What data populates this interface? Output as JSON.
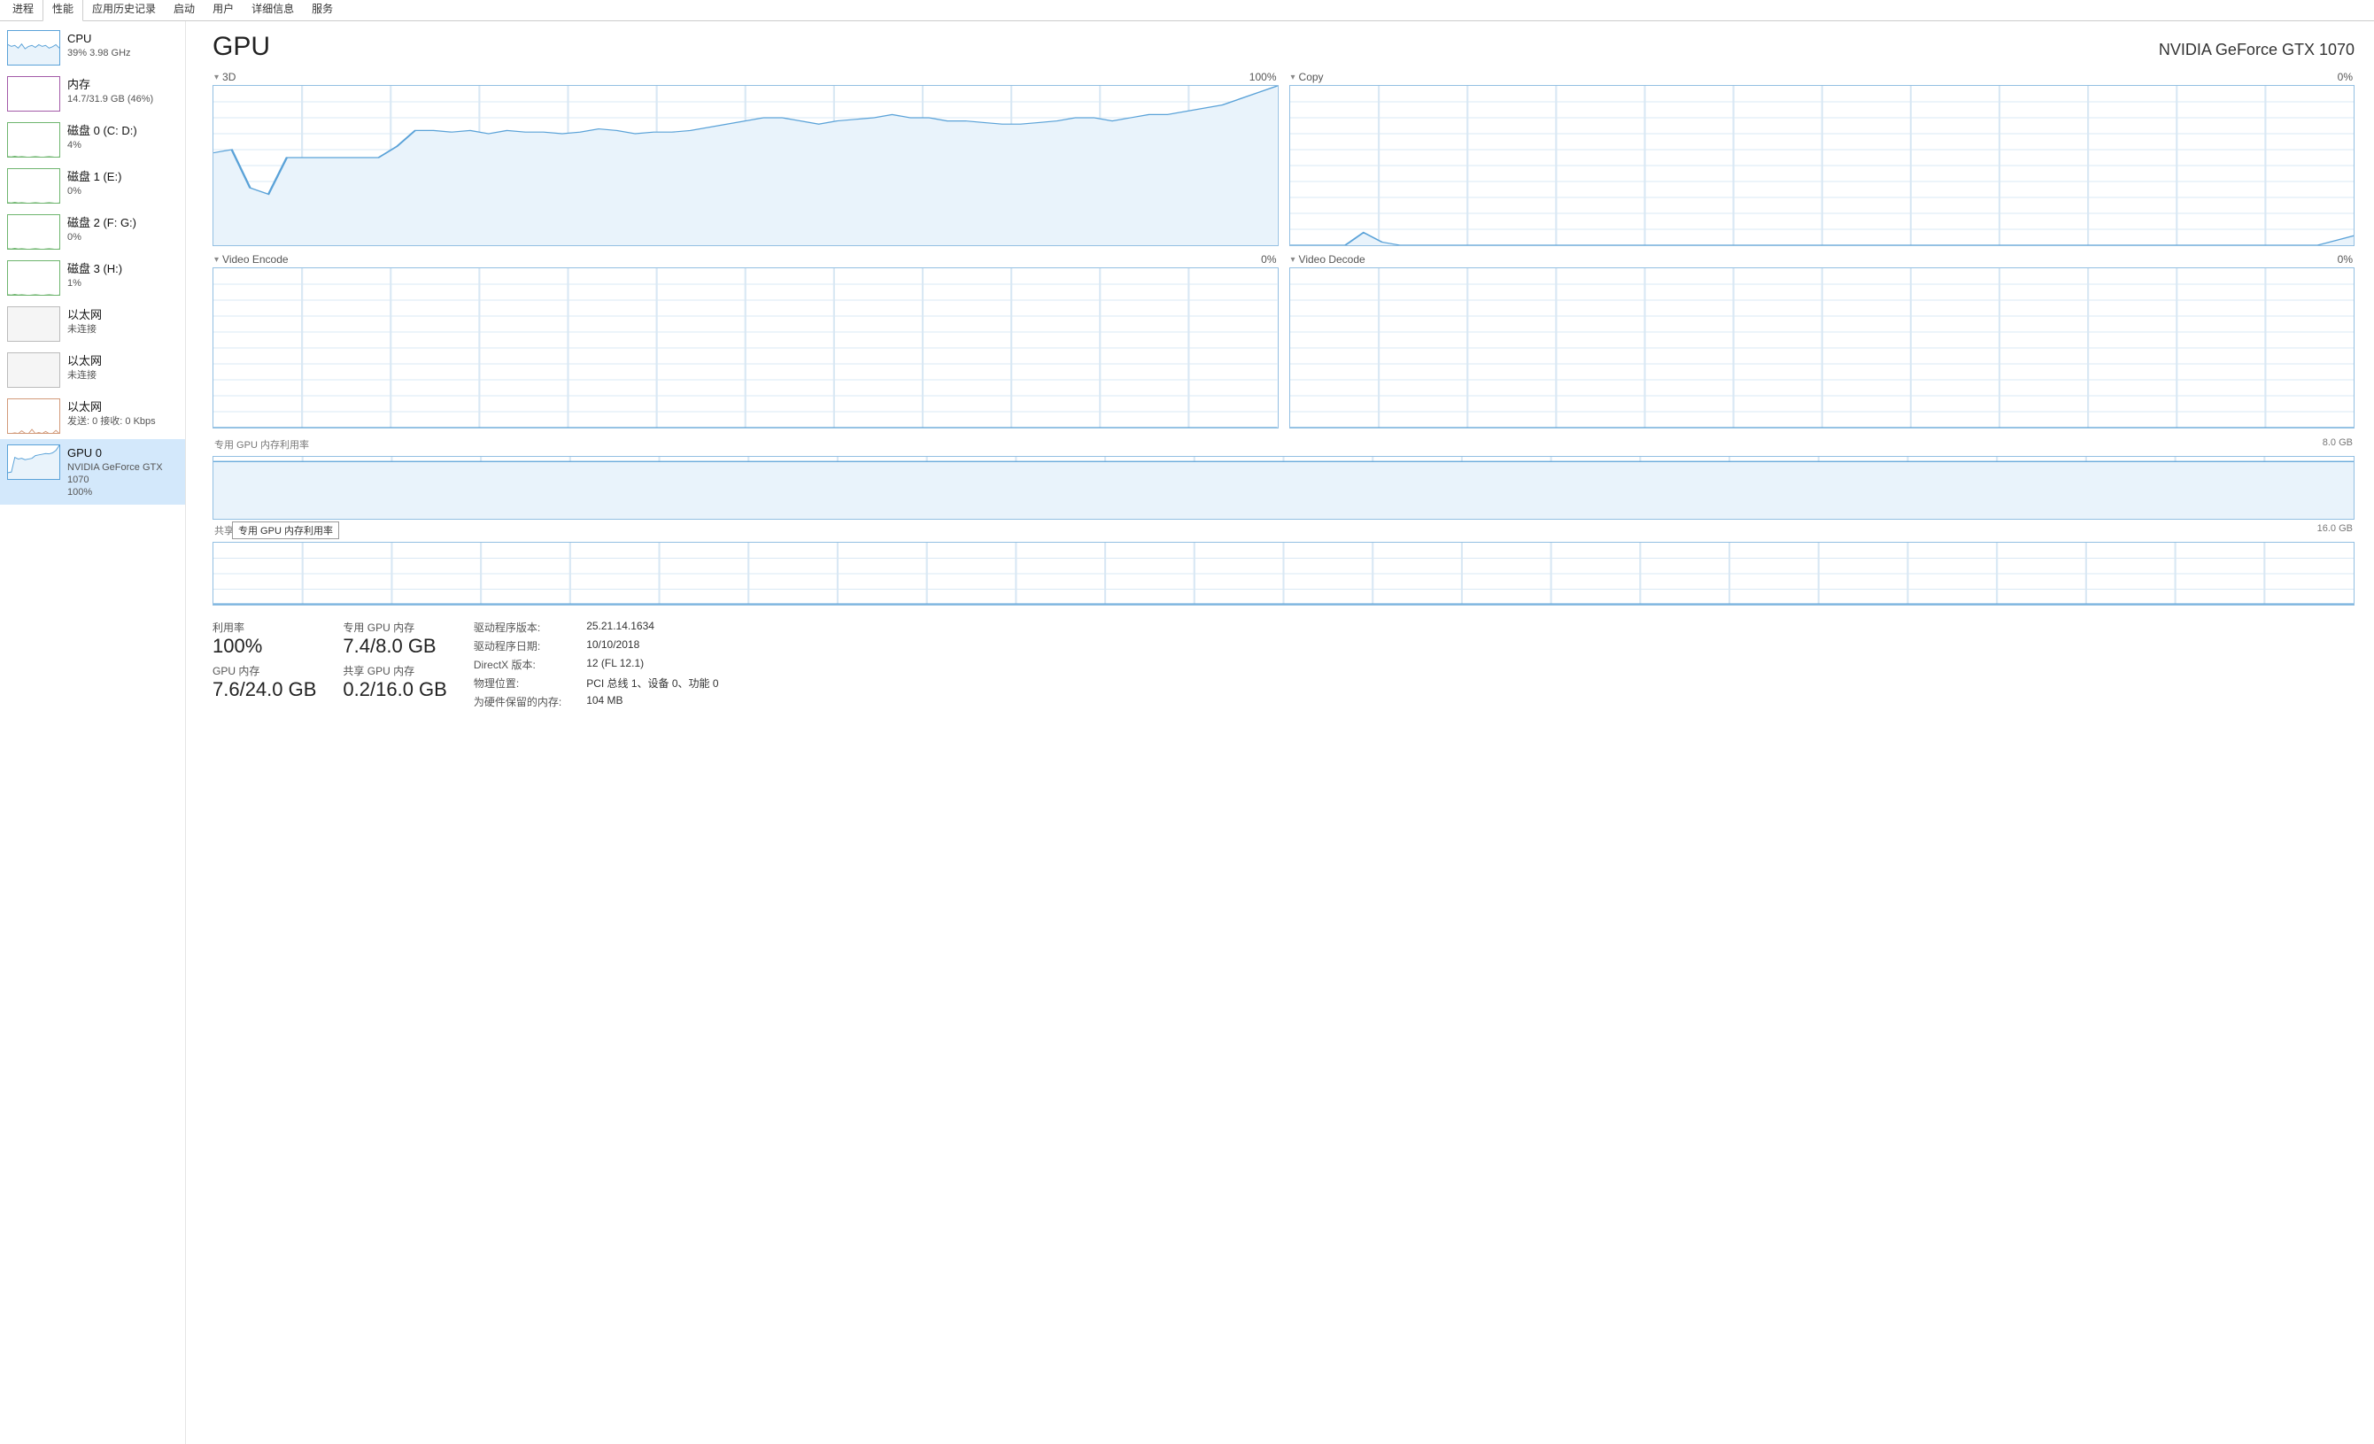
{
  "tabs": [
    "进程",
    "性能",
    "应用历史记录",
    "启动",
    "用户",
    "详细信息",
    "服务"
  ],
  "active_tab_index": 1,
  "sidebar": [
    {
      "id": "cpu",
      "title": "CPU",
      "sub": "39% 3.98 GHz",
      "thumb": "cpu"
    },
    {
      "id": "mem",
      "title": "内存",
      "sub": "14.7/31.9 GB (46%)",
      "thumb": "mem"
    },
    {
      "id": "disk0",
      "title": "磁盘 0 (C: D:)",
      "sub": "4%",
      "thumb": "disk"
    },
    {
      "id": "disk1",
      "title": "磁盘 1 (E:)",
      "sub": "0%",
      "thumb": "disk"
    },
    {
      "id": "disk2",
      "title": "磁盘 2 (F: G:)",
      "sub": "0%",
      "thumb": "disk"
    },
    {
      "id": "disk3",
      "title": "磁盘 3 (H:)",
      "sub": "1%",
      "thumb": "disk"
    },
    {
      "id": "eth0",
      "title": "以太网",
      "sub": "未连接",
      "thumb": "eth"
    },
    {
      "id": "eth1",
      "title": "以太网",
      "sub": "未连接",
      "thumb": "eth"
    },
    {
      "id": "eth2",
      "title": "以太网",
      "sub": "发送: 0 接收: 0 Kbps",
      "thumb": "eth2"
    },
    {
      "id": "gpu0",
      "title": "GPU 0",
      "sub": "NVIDIA GeForce GTX 1070",
      "sub2": "100%",
      "thumb": "gpu",
      "selected": true
    }
  ],
  "header": {
    "title": "GPU",
    "model": "NVIDIA GeForce GTX 1070"
  },
  "engines": [
    {
      "name": "3D",
      "right": "100%"
    },
    {
      "name": "Copy",
      "right": "0%"
    },
    {
      "name": "Video Encode",
      "right": "0%"
    },
    {
      "name": "Video Decode",
      "right": "0%"
    }
  ],
  "mem_charts": [
    {
      "label": "专用 GPU 内存利用率",
      "right": "8.0 GB"
    },
    {
      "label": "共享 GPU 内存利用率",
      "right": "16.0 GB"
    }
  ],
  "tooltip_text": "专用 GPU 内存利用率",
  "stats_big": [
    {
      "label": "利用率",
      "value": "100%"
    },
    {
      "label": "GPU 内存",
      "value": "7.6/24.0 GB"
    },
    {
      "label": "专用 GPU 内存",
      "value": "7.4/8.0 GB"
    },
    {
      "label": "共享 GPU 内存",
      "value": "0.2/16.0 GB"
    }
  ],
  "info": [
    {
      "k": "驱动程序版本:",
      "v": "25.21.14.1634"
    },
    {
      "k": "驱动程序日期:",
      "v": "10/10/2018"
    },
    {
      "k": "DirectX 版本:",
      "v": "12 (FL 12.1)"
    },
    {
      "k": "物理位置:",
      "v": "PCI 总线 1、设备 0、功能 0"
    },
    {
      "k": "为硬件保留的内存:",
      "v": "104 MB"
    }
  ],
  "chart_data": [
    {
      "type": "area",
      "name": "3D",
      "ylim": [
        0,
        100
      ],
      "values": [
        58,
        60,
        36,
        32,
        55,
        55,
        55,
        55,
        55,
        55,
        62,
        72,
        72,
        71,
        72,
        70,
        72,
        71,
        71,
        70,
        71,
        73,
        72,
        70,
        71,
        71,
        72,
        74,
        76,
        78,
        80,
        80,
        78,
        76,
        78,
        79,
        80,
        82,
        80,
        80,
        78,
        78,
        77,
        76,
        76,
        77,
        78,
        80,
        80,
        78,
        80,
        82,
        82,
        84,
        86,
        88,
        92,
        96,
        100
      ]
    },
    {
      "type": "area",
      "name": "Copy",
      "ylim": [
        0,
        100
      ],
      "values": [
        0,
        0,
        0,
        0,
        8,
        2,
        0,
        0,
        0,
        0,
        0,
        0,
        0,
        0,
        0,
        0,
        0,
        0,
        0,
        0,
        0,
        0,
        0,
        0,
        0,
        0,
        0,
        0,
        0,
        0,
        0,
        0,
        0,
        0,
        0,
        0,
        0,
        0,
        0,
        0,
        0,
        0,
        0,
        0,
        0,
        0,
        0,
        0,
        0,
        0,
        0,
        0,
        0,
        0,
        0,
        0,
        0,
        3,
        6
      ]
    },
    {
      "type": "area",
      "name": "Video Encode",
      "ylim": [
        0,
        100
      ],
      "values": [
        0,
        0,
        0,
        0,
        0,
        0,
        0,
        0,
        0,
        0,
        0,
        0,
        0,
        0,
        0,
        0,
        0,
        0,
        0,
        0,
        0,
        0,
        0,
        0,
        0,
        0,
        0,
        0,
        0,
        0,
        0,
        0,
        0,
        0,
        0,
        0,
        0,
        0,
        0,
        0,
        0,
        0,
        0,
        0,
        0,
        0,
        0,
        0,
        0,
        0,
        0,
        0,
        0,
        0,
        0,
        0,
        0,
        0,
        0
      ]
    },
    {
      "type": "area",
      "name": "Video Decode",
      "ylim": [
        0,
        100
      ],
      "values": [
        0,
        0,
        0,
        0,
        0,
        0,
        0,
        0,
        0,
        0,
        0,
        0,
        0,
        0,
        0,
        0,
        0,
        0,
        0,
        0,
        0,
        0,
        0,
        0,
        0,
        0,
        0,
        0,
        0,
        0,
        0,
        0,
        0,
        0,
        0,
        0,
        0,
        0,
        0,
        0,
        0,
        0,
        0,
        0,
        0,
        0,
        0,
        0,
        0,
        0,
        0,
        0,
        0,
        0,
        0,
        0,
        0,
        0,
        0
      ]
    },
    {
      "type": "area",
      "name": "dedicated_gpu_memory",
      "title": "专用 GPU 内存利用率",
      "ylim": [
        0,
        8.0
      ],
      "unit": "GB",
      "values": [
        7.4,
        7.4,
        7.4,
        7.4,
        7.4,
        7.4,
        7.4,
        7.4,
        7.4,
        7.4,
        7.4,
        7.4,
        7.4,
        7.4,
        7.4,
        7.4,
        7.4,
        7.4,
        7.4,
        7.4,
        7.4,
        7.4,
        7.4,
        7.4,
        7.4,
        7.4,
        7.4,
        7.4,
        7.4,
        7.4,
        7.4,
        7.4,
        7.4,
        7.4,
        7.4,
        7.4,
        7.4,
        7.4,
        7.4,
        7.4,
        7.4,
        7.4,
        7.4,
        7.4,
        7.4,
        7.4,
        7.4,
        7.4,
        7.4,
        7.4,
        7.4,
        7.4,
        7.4,
        7.4,
        7.4,
        7.4,
        7.4,
        7.4,
        7.4
      ]
    },
    {
      "type": "area",
      "name": "shared_gpu_memory",
      "title": "共享 GPU 内存利用率",
      "ylim": [
        0,
        16.0
      ],
      "unit": "GB",
      "values": [
        0.2,
        0.2,
        0.2,
        0.2,
        0.2,
        0.2,
        0.2,
        0.2,
        0.2,
        0.2,
        0.2,
        0.2,
        0.2,
        0.2,
        0.2,
        0.2,
        0.2,
        0.2,
        0.2,
        0.2,
        0.2,
        0.2,
        0.2,
        0.2,
        0.2,
        0.2,
        0.2,
        0.2,
        0.2,
        0.2,
        0.2,
        0.2,
        0.2,
        0.2,
        0.2,
        0.2,
        0.2,
        0.2,
        0.2,
        0.2,
        0.2,
        0.2,
        0.2,
        0.2,
        0.2,
        0.2,
        0.2,
        0.2,
        0.2,
        0.2,
        0.2,
        0.2,
        0.2,
        0.2,
        0.2,
        0.2,
        0.2,
        0.2,
        0.2
      ]
    }
  ],
  "sidebar_thumbs": {
    "cpu": [
      60,
      55,
      58,
      50,
      62,
      48,
      55,
      58,
      52,
      60,
      55,
      58,
      50,
      54,
      60,
      50
    ],
    "gpu": [
      20,
      22,
      65,
      60,
      62,
      58,
      60,
      62,
      70,
      72,
      74,
      76,
      75,
      78,
      85,
      100
    ],
    "eth2": [
      0,
      0,
      2,
      0,
      8,
      1,
      0,
      12,
      0,
      3,
      0,
      6,
      0,
      0,
      9,
      0
    ]
  }
}
